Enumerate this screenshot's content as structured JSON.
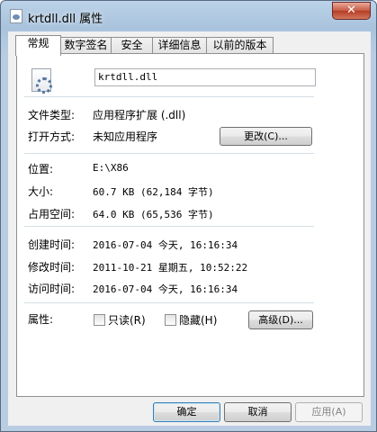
{
  "window": {
    "title": "krtdll.dll 属性",
    "close_glyph": "✕"
  },
  "tabs": [
    "常规",
    "数字签名",
    "安全",
    "详细信息",
    "以前的版本"
  ],
  "file": {
    "name": "krtdll.dll",
    "icon": "dll-file-icon"
  },
  "fields": {
    "type_label": "文件类型:",
    "type_value": "应用程序扩展 (.dll)",
    "opens_label": "打开方式:",
    "opens_value": "未知应用程序",
    "change_button": "更改(C)...",
    "location_label": "位置:",
    "location_value": "E:\\X86",
    "size_label": "大小:",
    "size_value": "60.7 KB (62,184 字节)",
    "disk_label": "占用空间:",
    "disk_value": "64.0 KB (65,536 字节)",
    "created_label": "创建时间:",
    "created_value": "2016-07-04 今天, 16:16:34",
    "modified_label": "修改时间:",
    "modified_value": "2011-10-21 星期五, 10:52:22",
    "accessed_label": "访问时间:",
    "accessed_value": "2016-07-04 今天, 16:16:34",
    "attr_label": "属性:",
    "readonly_label": "只读(R)",
    "hidden_label": "隐藏(H)",
    "advanced_button": "高级(D)..."
  },
  "buttons": {
    "ok": "确定",
    "cancel": "取消",
    "apply": "应用(A)"
  }
}
